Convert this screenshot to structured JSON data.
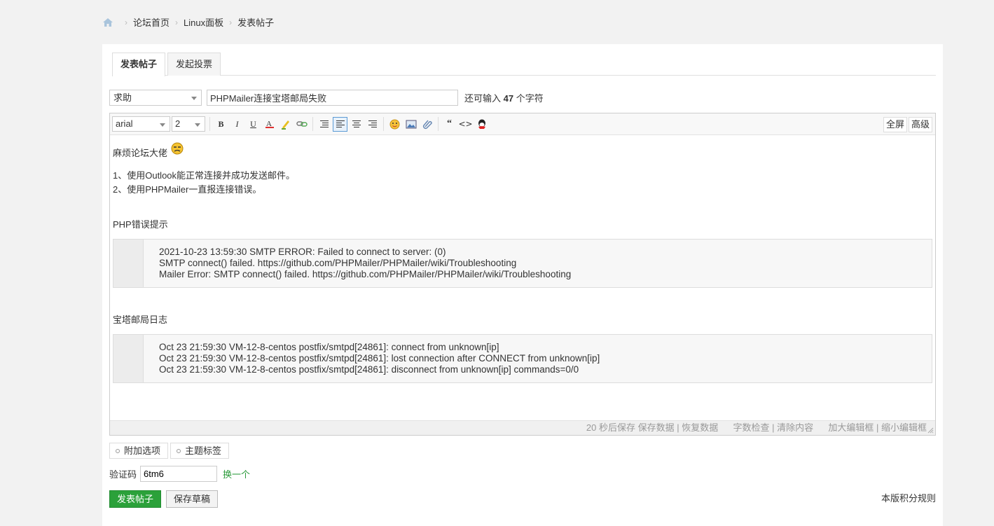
{
  "breadcrumb": {
    "items": [
      "论坛首页",
      "Linux面板",
      "发表帖子"
    ]
  },
  "tabs": [
    "发表帖子",
    "发起投票"
  ],
  "post": {
    "category": "求助",
    "title": "PHPMailer连接宝塔邮局失败",
    "remaining_prefix": "还可输入",
    "remaining_count": "47",
    "remaining_suffix": "个字符"
  },
  "toolbar": {
    "font": "arial",
    "size": "2",
    "fullscreen": "全屏",
    "advanced": "高级"
  },
  "content": {
    "line1": "麻烦论坛大佬",
    "line2": "1、使用Outlook能正常连接并成功发送邮件。",
    "line3": "2、使用PHPMailer一直报连接错误。",
    "heading1": "PHP错误提示",
    "code1": [
      "2021-10-23 13:59:30 SMTP ERROR: Failed to connect to server: (0)",
      "SMTP connect() failed. https://github.com/PHPMailer/PHPMailer/wiki/Troubleshooting",
      "Mailer Error: SMTP connect() failed. https://github.com/PHPMailer/PHPMailer/wiki/Troubleshooting"
    ],
    "heading2": "宝塔邮局日志",
    "code2": [
      "Oct 23 21:59:30 VM-12-8-centos postfix/smtpd[24861]: connect from unknown[ip]",
      "Oct 23 21:59:30 VM-12-8-centos postfix/smtpd[24861]: lost connection after CONNECT from unknown[ip]",
      "Oct 23 21:59:30 VM-12-8-centos postfix/smtpd[24861]: disconnect from unknown[ip] commands=0/0"
    ]
  },
  "statusbar": {
    "autosave": "20 秒后保存",
    "save": "保存数据",
    "restore": "恢复数据",
    "check": "字数检查",
    "clear": "清除内容",
    "enlarge": "加大编辑框",
    "shrink": "缩小编辑框"
  },
  "extras": [
    "附加选项",
    "主题标签"
  ],
  "captcha": {
    "label": "验证码",
    "value": "6tm6",
    "change": "换一个"
  },
  "actions": {
    "submit": "发表帖子",
    "draft": "保存草稿",
    "rules": "本版积分规则"
  },
  "colors": {
    "accent": "#2ba13a"
  }
}
